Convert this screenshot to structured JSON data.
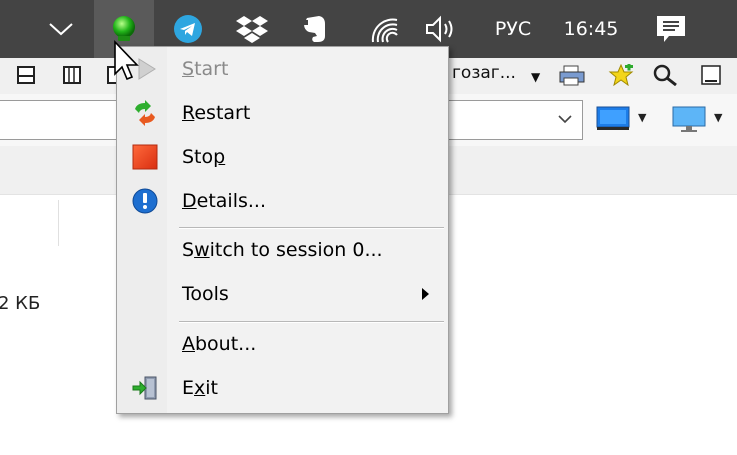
{
  "taskbar": {
    "language": "РУС",
    "time": "16:45",
    "colors": {
      "background": "#444444",
      "active_tile": "#5a5a5a"
    },
    "icons": [
      "chevron-up-icon",
      "green-status-light-icon",
      "telegram-icon",
      "dropbox-icon",
      "evernote-icon",
      "wifi-icon",
      "volume-icon",
      "notification-icon"
    ]
  },
  "app": {
    "toolbar_label": "гозаг...",
    "file_size": "2 КБ"
  },
  "menu": {
    "items": [
      {
        "label": "Start",
        "access_key": "S",
        "enabled": false,
        "icon": "play-arrow-icon"
      },
      {
        "label": "Restart",
        "access_key": "R",
        "enabled": true,
        "icon": "restart-icon"
      },
      {
        "label": "Stop",
        "access_key": "p",
        "enabled": true,
        "icon": "stop-square-icon"
      },
      {
        "label": "Details...",
        "access_key": "D",
        "enabled": true,
        "icon": "info-icon"
      },
      {
        "label": "Switch to session 0...",
        "access_key": "w",
        "enabled": true,
        "icon": ""
      },
      {
        "label": "Tools",
        "access_key": "",
        "enabled": true,
        "icon": "",
        "submenu": true
      },
      {
        "label": "About...",
        "access_key": "A",
        "enabled": true,
        "icon": ""
      },
      {
        "label": "Exit",
        "access_key": "x",
        "enabled": true,
        "icon": "exit-door-icon"
      }
    ],
    "colors": {
      "background": "#f2f2f2",
      "disabled_text": "#8a8a8a",
      "stop": "#e8401c",
      "info": "#1e6fd0"
    }
  }
}
